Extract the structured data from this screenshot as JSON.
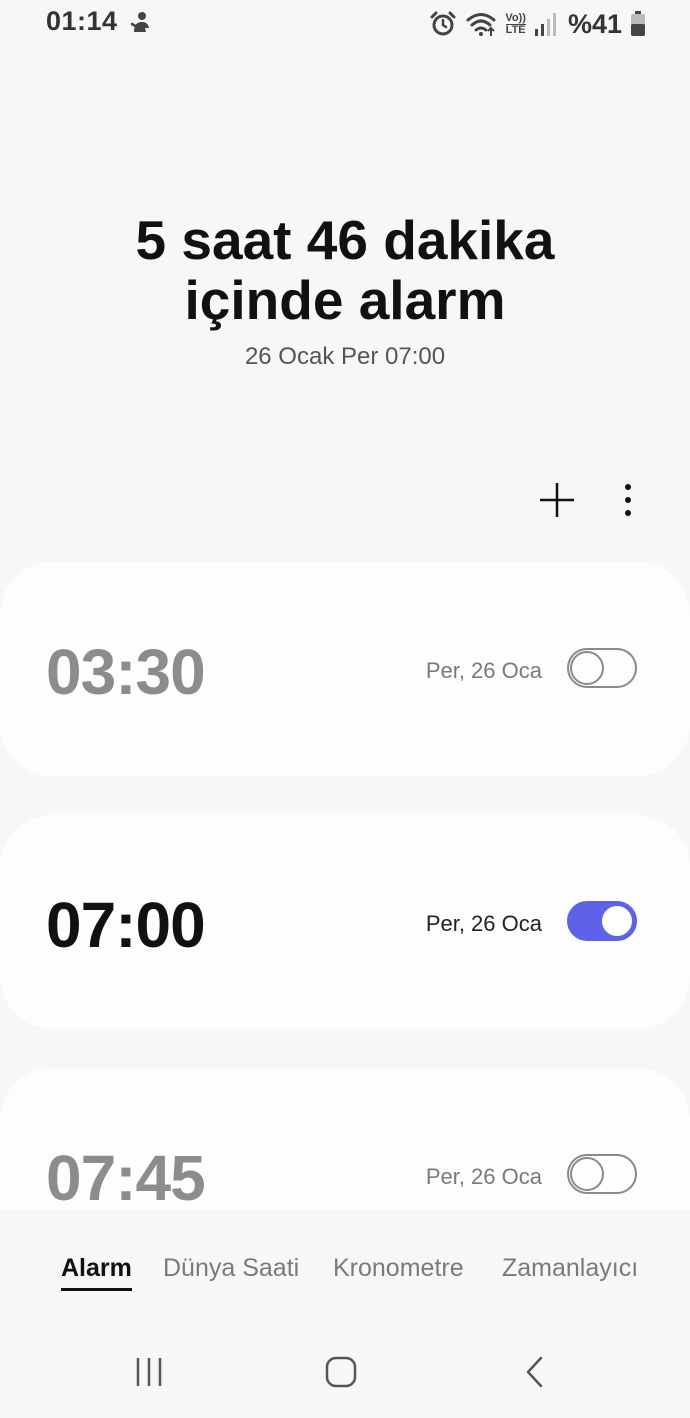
{
  "status_bar": {
    "time": "01:14",
    "battery": "%41",
    "icons": [
      "person-icon",
      "alarm-icon",
      "wifi-icon",
      "volte-icon",
      "signal-icon",
      "battery-icon"
    ],
    "volte_top": "Vo))",
    "volte_bottom": "LTE"
  },
  "header": {
    "next_alarm_line1": "5 saat 46 dakika",
    "next_alarm_line2": "içinde alarm",
    "next_alarm_date": "26 Ocak Per 07:00"
  },
  "toolbar": {
    "add_icon": "plus-icon",
    "more_icon": "more-vert-icon"
  },
  "alarms": [
    {
      "time": "03:30",
      "date": "Per, 26 Oca",
      "enabled": false
    },
    {
      "time": "07:00",
      "date": "Per, 26 Oca",
      "enabled": true
    },
    {
      "time": "07:45",
      "date": "Per, 26 Oca",
      "enabled": false
    }
  ],
  "tabs": [
    {
      "label": "Alarm",
      "active": true
    },
    {
      "label": "Dünya Saati",
      "active": false
    },
    {
      "label": "Kronometre",
      "active": false
    },
    {
      "label": "Zamanlayıcı",
      "active": false
    }
  ],
  "nav": {
    "icons": [
      "recent-apps-icon",
      "home-icon",
      "back-icon"
    ]
  },
  "colors": {
    "background": "#f7f7f7",
    "card": "#fdfdfd",
    "accent": "#5f62e8",
    "inactive_text": "#8c8c8c"
  }
}
